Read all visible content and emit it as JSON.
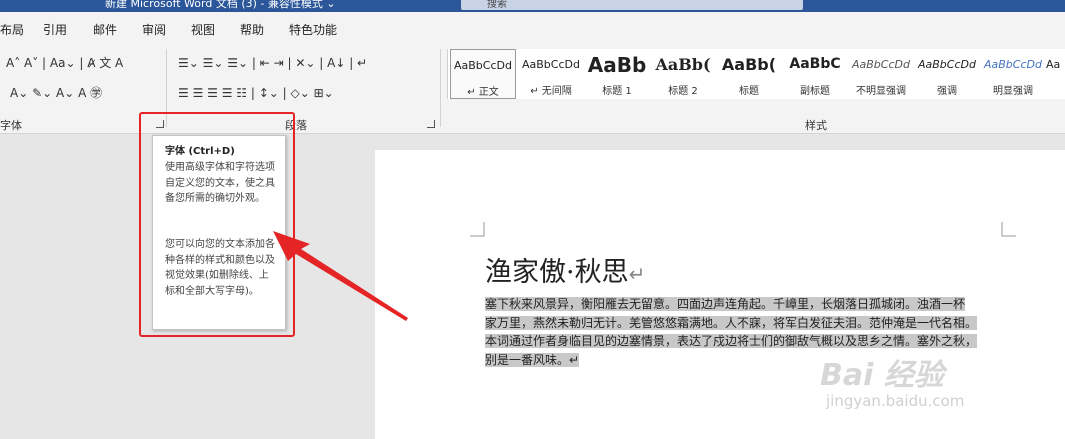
{
  "titlebar": {
    "title": "新建 Microsoft Word 文档 (3) - 兼容性模式 ⌄",
    "search_placeholder": "搜索"
  },
  "menu": [
    "布局",
    "引用",
    "邮件",
    "审阅",
    "视图",
    "帮助",
    "特色功能"
  ],
  "ribbon": {
    "font_group_label": "字体",
    "paragraph_group_label": "段落",
    "styles_group_label": "样式",
    "font_row1": "A˄ A˅ | Aa⌄ | A̷ 文 A",
    "font_row2": "A⌄ ✎⌄ A⌄ A ㊫",
    "para_row1": "☰⌄ ☰⌄ ☰⌄ | ⇤ ⇥ | ✕⌄ | A↓ | ↵",
    "para_row2": "☰ ☰ ☰ ☰ ☷ | ↕⌄ | ◇⌄ ⊞⌄",
    "styles": [
      {
        "sample": "AaBbCcDd",
        "name": "↵ 正文"
      },
      {
        "sample": "AaBbCcDd",
        "name": "↵ 无间隔"
      },
      {
        "sample": "AaBb",
        "name": "标题 1"
      },
      {
        "sample": "AaBb(",
        "name": "标题 2"
      },
      {
        "sample": "AaBb(",
        "name": "标题"
      },
      {
        "sample": "AaBbC",
        "name": "副标题"
      },
      {
        "sample": "AaBbCcDd",
        "name": "不明显强调"
      },
      {
        "sample": "AaBbCcDd",
        "name": "强调"
      },
      {
        "sample": "AaBbCcDd",
        "name": "明显强调"
      },
      {
        "sample": "Aa",
        "name": ""
      }
    ]
  },
  "tooltip": {
    "title": "字体 (Ctrl+D)",
    "para1": "使用高级字体和字符选项自定义您的文本，使之具备您所需的确切外观。",
    "para2": "您可以向您的文本添加各种各样的样式和颜色以及视觉效果(如删除线、上标和全部大写字母)。"
  },
  "document": {
    "title": "渔家傲·秋思",
    "title_mark": "↵",
    "lines": [
      "塞下秋来风景异，衡阳雁去无留意。四面边声连角起。千嶂里，长烟落日孤城闭。浊酒一杯",
      "家万里，燕然未勒归无计。羌管悠悠霜满地。人不寐，将军白发征夫泪。范仲淹是一代名相。",
      "本词通过作者身临目见的边塞情景，表达了戍边将士们的御敌气概以及思乡之情。塞外之秋，",
      "别是一番风味。↵"
    ]
  },
  "watermark": {
    "line1": "Bai 经验",
    "line2": "jingyan.baidu.com"
  },
  "colors": {
    "title_bar": "#2b579a",
    "highlight_box": "#e52525",
    "arrow": "#e52525"
  }
}
